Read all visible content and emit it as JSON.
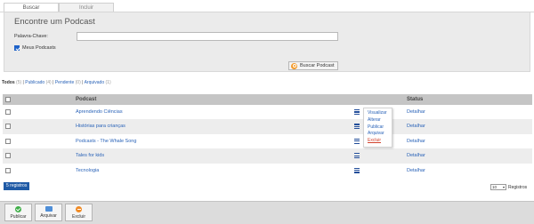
{
  "tabs": [
    {
      "label": "Buscar",
      "active": true
    },
    {
      "label": "Incluir",
      "active": false
    }
  ],
  "search": {
    "title": "Encontre um Podcast",
    "keyword_label": "Palavra-Chave:",
    "keyword_value": "",
    "my_podcasts_label": "Meus Podcasts",
    "my_podcasts_checked": true,
    "button_label": "Buscar Podcast"
  },
  "filters": {
    "all_label": "Todos",
    "all_count": "(5)",
    "sep": "|",
    "published_label": "Publicado",
    "published_count": "(4)",
    "pending_label": "Pendente",
    "pending_count": "(0)",
    "archived_label": "Arquivado",
    "archived_count": "(1)"
  },
  "table": {
    "columns": [
      "",
      "Podcast",
      "Status"
    ],
    "rows": [
      {
        "title": "Aprendendo Ciências",
        "status_link": "Detalhar"
      },
      {
        "title": "Histórias para crianças",
        "status_link": "Detalhar"
      },
      {
        "title": "Podcasts - The Whale Song",
        "status_link": "Detalhar"
      },
      {
        "title": "Tales for kids",
        "status_link": "Detalhar"
      },
      {
        "title": "Tecnologia",
        "status_link": "Detalhar"
      }
    ]
  },
  "row_menu": {
    "items": [
      "Visualizar",
      "Alterar",
      "Publicar",
      "Arquivar",
      "Excluir"
    ]
  },
  "footer": {
    "count_badge": "5 registros",
    "page_size": "10",
    "page_size_suffix": "Registros"
  },
  "actions": {
    "publish": "Publicar",
    "archive": "Arquivar",
    "delete": "Excluir"
  },
  "colors": {
    "link": "#2a63b8",
    "accent": "#1f5aa6",
    "danger": "#d2422d"
  },
  "icons": {
    "search_button": "search-icon",
    "row_menu": "hamburger-menu-icon",
    "publish": "check-circle-icon",
    "archive": "archive-box-icon",
    "delete": "minus-circle-icon"
  }
}
